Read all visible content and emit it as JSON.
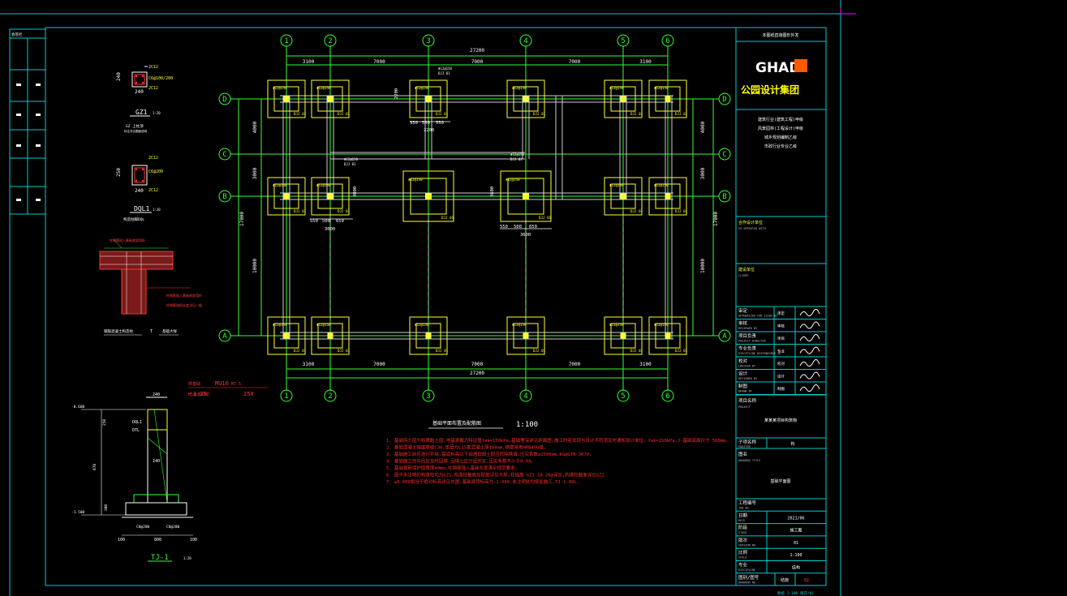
{
  "drawing": {
    "top_label": "本图纸直接图形外发",
    "plan_title": "基础平面布置及配筋图",
    "plan_scale": "1:100",
    "overall_dimension": "27200",
    "top_spans": [
      "3100",
      "7000",
      "7000",
      "7000",
      "3100"
    ],
    "bottom_spans": [
      "3100",
      "7000",
      "7000",
      "7000",
      "3100"
    ],
    "right_spans": [
      "4000",
      "3000",
      "10000"
    ],
    "right_total": "17000",
    "left_spans": [
      "4000",
      "3000",
      "10000"
    ],
    "left_total": "17000",
    "x_axes": [
      "1",
      "2",
      "3",
      "4",
      "5",
      "6"
    ],
    "y_axes": [
      "D",
      "C",
      "B",
      "A"
    ],
    "footing_tag": "DJJ 01",
    "footing_rebar": "Φ12@150",
    "callout_1_dims": [
      "550",
      "500",
      "550",
      "2200"
    ],
    "callout_2_dims": [
      "550",
      "500",
      "650",
      "3000"
    ],
    "callout_3_dims": [
      "550",
      "500",
      "650",
      "3600"
    ],
    "callout_1_vertical": "2200",
    "callout_2_vertical": "3000",
    "callout_3_vertical": "3600"
  },
  "details": {
    "gz1_rebar_top": "2C12",
    "gz1_stirrup": "C6@100/200",
    "gz1_rebar_bottom": "2C12",
    "gz1_dim_w": "240",
    "gz1_dim_h": "240",
    "gz1_label": "GZ1",
    "gz1_scale": "1:20",
    "gz1_note": "GZ 上柱顶",
    "gz1_note2": "标注详见图面说明",
    "dql_rebar_top": "2C12",
    "dql_stirrup": "C6@200",
    "dql_rebar_bottom": "2C12",
    "dql_dim_w": "240",
    "dql_dim_h": "250",
    "dql_label": "DQL1",
    "dql_scale": "1:20",
    "dql_note": "构造柱脚DQL",
    "wall_note_1": "柱钢筋插入基础底部弯折",
    "wall_note_2": "柱钢筋锚固长度详见一般",
    "wall_footer_left": "钢筋混凝土构造柱",
    "wall_footer_mid": "T",
    "wall_footer_right": "基础大样",
    "tj_label": "TJ-1",
    "tj_scale": "1:20",
    "tj_dims": [
      "100",
      "800",
      "100"
    ],
    "tj_elev_top": "-0.600",
    "tj_elev_bottom": "-1.500",
    "tj_dim_240": "240",
    "tj_dql": "DQL1",
    "tj_dtl": "DTL",
    "tj_rebar": "C8@200",
    "tj_rebar2": "C8@200",
    "tj_red_label": "MU10",
    "tj_red_label2": "M7.5",
    "tj_side_dims": [
      "250",
      "870",
      "300"
    ],
    "tj_note_red": "砖基础",
    "tj_note_red2": "M5水泥砂浆",
    "tj_scale_red": "1:25"
  },
  "notes": [
    "1. 基础持力层为粉质黏土层,地基承载力特征值fak=150kPa,基础埋深详见剖面图,施工时若发现与设计不符须及时通知设计单位。fak=150kPa,J-基础底面尺寸 500mm。",
    "2. 基础混凝土强度等级C30,垫层为C15素混凝土厚100mm,钢筋采用HRB400级。",
    "3. 基础施工前应进行钎探,基底标高以下如遇软弱土层应挖除换填,压实系数≥2500mm,KG@GTB-3070,",
    "4. 基础施工完毕后应及时回填,回填土应分层夯实,压实系数不小于0.94。",
    "5. 基础钢筋保护层厚度40mm,柱钢筋锚入基础长度满足规范要求。",
    "6. 图中未注明的构造柱均为GZ1,构造柱截面及配筋详见大样,柱插筋 GZ1 10-20@详见,构造柱截面详见GZ1",
    "7. ±0.000相当于绝对标高详见总图,基础梁顶标高为-1.000,未注明处均按此施工,TJ-1.00L,"
  ],
  "title_block": {
    "header": "本图纸直接图形外发",
    "logo": "GHAD",
    "brand": "公园设计集团",
    "qualifications": [
      "建筑行业(建筑工程)甲级",
      "风景园林(工程设计)甲级",
      "城乡规划编制乙级",
      "市政行业专业乙级"
    ],
    "coop_label": "合作设计单位",
    "coop_en": "CO-OPERATED WITH",
    "client_label": "建设单位",
    "client_en": "CLIENT",
    "roles": [
      {
        "label": "审定",
        "en": "AUTHORIZED FOR ISSUE BY",
        "code": "审定"
      },
      {
        "label": "审核",
        "en": "REVIEWED BY",
        "code": "审核"
      },
      {
        "label": "项目负责",
        "en": "PROJECT DIRECTOR",
        "code": "项目"
      },
      {
        "label": "专业负责",
        "en": "DISCIPLINE RESPONSIBLE BY",
        "code": "专业"
      },
      {
        "label": "校对",
        "en": "CHECKED BY",
        "code": "校对"
      },
      {
        "label": "设计",
        "en": "DESIGNED BY",
        "code": "设计"
      },
      {
        "label": "制图",
        "en": "DRAWN BY",
        "code": "制图"
      }
    ],
    "project_label": "项目名称",
    "project_en": "PROJECT",
    "project_value": "某某某项目构筑物",
    "subitem_label": "子项名称",
    "subitem_en": "SUBITEM",
    "subitem_value": "构",
    "drawing_name_label": "图名",
    "drawing_name_en": "DRAWING TITLE",
    "drawing_name_value": "基础平面图",
    "job_no_label": "工程编号",
    "job_no_en": "JOB NO.",
    "date_label": "日期",
    "date_en": "DATE",
    "date_value": "2021/06",
    "stage_label": "阶段",
    "stage_en": "STAGE",
    "stage_value": "施工图",
    "version_label": "版次",
    "version_en": "VERSION NO.",
    "version_value": "01",
    "scale_label": "比例",
    "scale_en": "SCALE",
    "scale_value": "1:100",
    "discipline_label": "专业",
    "discipline_en": "DISCIPLINE",
    "discipline_value": "结构",
    "sheet_label": "图别/图号",
    "sheet_en": "DRAWING NO.",
    "sheet_type": "结施",
    "sheet_no": "02",
    "footer": "图纸 1:100 版次/01"
  },
  "left_strip": {
    "title": "会签栏"
  },
  "colors": {
    "frame": "#00cccc",
    "axis": "#33ff33",
    "footing": "#ffff33",
    "beam": "#cccccc",
    "note": "#ff2a2a",
    "dimension": "#ffffff",
    "brand": "#ffff00",
    "logo_box": "#ff5a00"
  }
}
